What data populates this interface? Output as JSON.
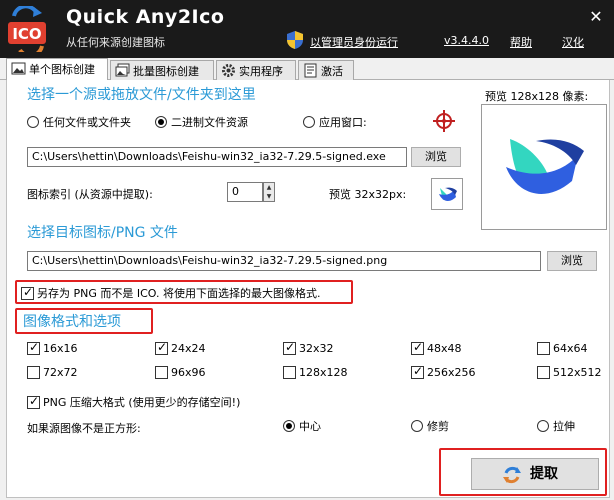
{
  "header": {
    "title": "Quick Any2Ico",
    "subtitle": "从任何来源创建图标",
    "admin_link": "以管理员身份运行",
    "version": "v3.4.4.0",
    "help": "帮助",
    "language": "汉化",
    "close": "✕"
  },
  "tabs": [
    {
      "label": "单个图标创建",
      "active": true
    },
    {
      "label": "批量图标创建",
      "active": false
    },
    {
      "label": "实用程序",
      "active": false
    },
    {
      "label": "激活",
      "active": false
    }
  ],
  "source": {
    "title": "选择一个源或拖放文件/文件夹到这里",
    "options": [
      "任何文件或文件夹",
      "二进制文件资源",
      "应用窗口:"
    ],
    "selected_index": 1,
    "path": "C:\\Users\\hettin\\Downloads\\Feishu-win32_ia32-7.29.5-signed.exe",
    "browse": "浏览",
    "index_label": "图标索引 (从资源中提取):",
    "index_value": "0",
    "preview_small_label": "预览 32x32px:",
    "preview_big_label": "预览 128x128 像素:"
  },
  "target": {
    "title": "选择目标图标/PNG 文件",
    "path": "C:\\Users\\hettin\\Downloads\\Feishu-win32_ia32-7.29.5-signed.png",
    "browse": "浏览"
  },
  "save_png": {
    "label": "另存为 PNG 而不是 ICO. 将使用下面选择的最大图像格式.",
    "checked": true
  },
  "formats": {
    "title": "图像格式和选项",
    "items": [
      {
        "label": "16x16",
        "checked": true
      },
      {
        "label": "24x24",
        "checked": true
      },
      {
        "label": "32x32",
        "checked": true
      },
      {
        "label": "48x48",
        "checked": true
      },
      {
        "label": "64x64",
        "checked": false
      },
      {
        "label": "72x72",
        "checked": false
      },
      {
        "label": "96x96",
        "checked": false
      },
      {
        "label": "128x128",
        "checked": false
      },
      {
        "label": "256x256",
        "checked": true
      },
      {
        "label": "512x512",
        "checked": false
      }
    ],
    "png_compress": "PNG 压缩大格式 (使用更少的存储空间!)",
    "png_compress_checked": true,
    "nonsquare_label": "如果源图像不是正方形:",
    "nonsquare_options": [
      "中心",
      "修剪",
      "拉伸"
    ],
    "nonsquare_selected": 0
  },
  "extract_button": "提取",
  "colors": {
    "accent": "#2b9ad6",
    "highlight": "#e02020"
  }
}
